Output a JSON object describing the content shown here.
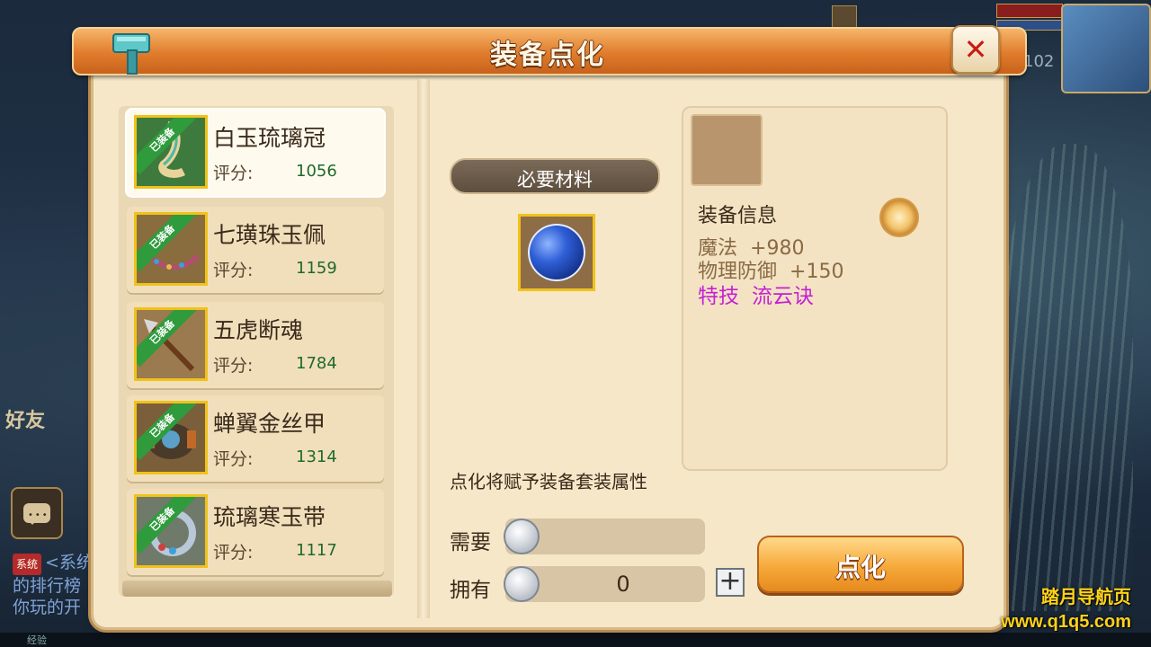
{
  "window": {
    "title": "装备点化"
  },
  "equipment_list": [
    {
      "name": "白玉琉璃冠",
      "badge": "已装备",
      "score_label": "评分:",
      "score": "1056",
      "selected": true
    },
    {
      "name": "七璜珠玉佩",
      "badge": "已装备",
      "score_label": "评分:",
      "score": "1159",
      "selected": false
    },
    {
      "name": "五虎断魂",
      "badge": "已装备",
      "score_label": "评分:",
      "score": "1784",
      "selected": false
    },
    {
      "name": "蝉翼金丝甲",
      "badge": "已装备",
      "score_label": "评分:",
      "score": "1314",
      "selected": false
    },
    {
      "name": "琉璃寒玉带",
      "badge": "已装备",
      "score_label": "评分:",
      "score": "1117",
      "selected": false
    }
  ],
  "materials": {
    "banner": "必要材料",
    "item_icon": "blue-orb-icon",
    "hint": "点化将赋予装备套装属性"
  },
  "cost": {
    "need_label": "需要",
    "need_value": "",
    "have_label": "拥有",
    "have_value": "0",
    "currency_icon": "silver-coin-icon",
    "plus_label": "+"
  },
  "action": {
    "label": "点化"
  },
  "info": {
    "title": "装备信息",
    "stats": [
      {
        "name": "魔法",
        "value": "+980"
      },
      {
        "name": "物理防御",
        "value": "+150"
      }
    ],
    "special": {
      "name": "特技",
      "value": "流云诀"
    }
  },
  "hud": {
    "level": "102",
    "friend_label": "好友",
    "chat_lines": [
      "<系统",
      "的排行榜",
      "你玩的开"
    ],
    "chat_tag": "系统",
    "exp_label": "经验"
  },
  "watermark": {
    "line1": "踏月导航页",
    "line2": "www.q1q5.com"
  },
  "colors": {
    "score_green": "#1f6a2a",
    "special_purple": "#c51fd6",
    "title_orange": "#e07c2c",
    "close_red": "#c91b12"
  }
}
